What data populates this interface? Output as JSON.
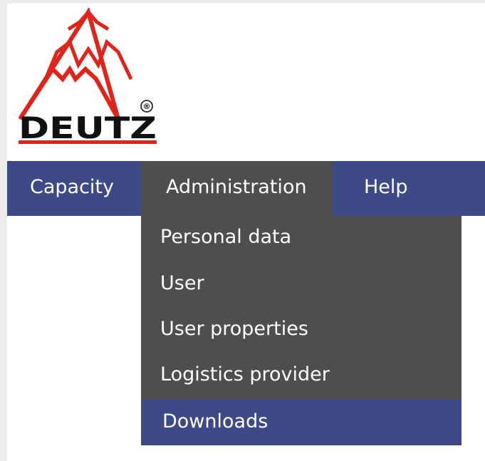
{
  "logo": {
    "text": "DEUTZ",
    "registered_mark": "®",
    "icon": "deutz-logo"
  },
  "colors": {
    "menubar": "#3e4a86",
    "menu_active": "#4e4e4e",
    "dropdown_bg": "#4e4e4e",
    "dropdown_highlight": "#3e4a86",
    "logo_red": "#e2231a",
    "logo_black": "#111111"
  },
  "menubar": {
    "items": [
      {
        "label": "Capacity"
      },
      {
        "label": "Administration",
        "active": true
      },
      {
        "label": "Help"
      }
    ]
  },
  "dropdown": {
    "items": [
      {
        "label": "Personal data"
      },
      {
        "label": "User"
      },
      {
        "label": "User properties"
      },
      {
        "label": "Logistics provider"
      },
      {
        "label": "Downloads",
        "highlighted": true
      }
    ]
  }
}
